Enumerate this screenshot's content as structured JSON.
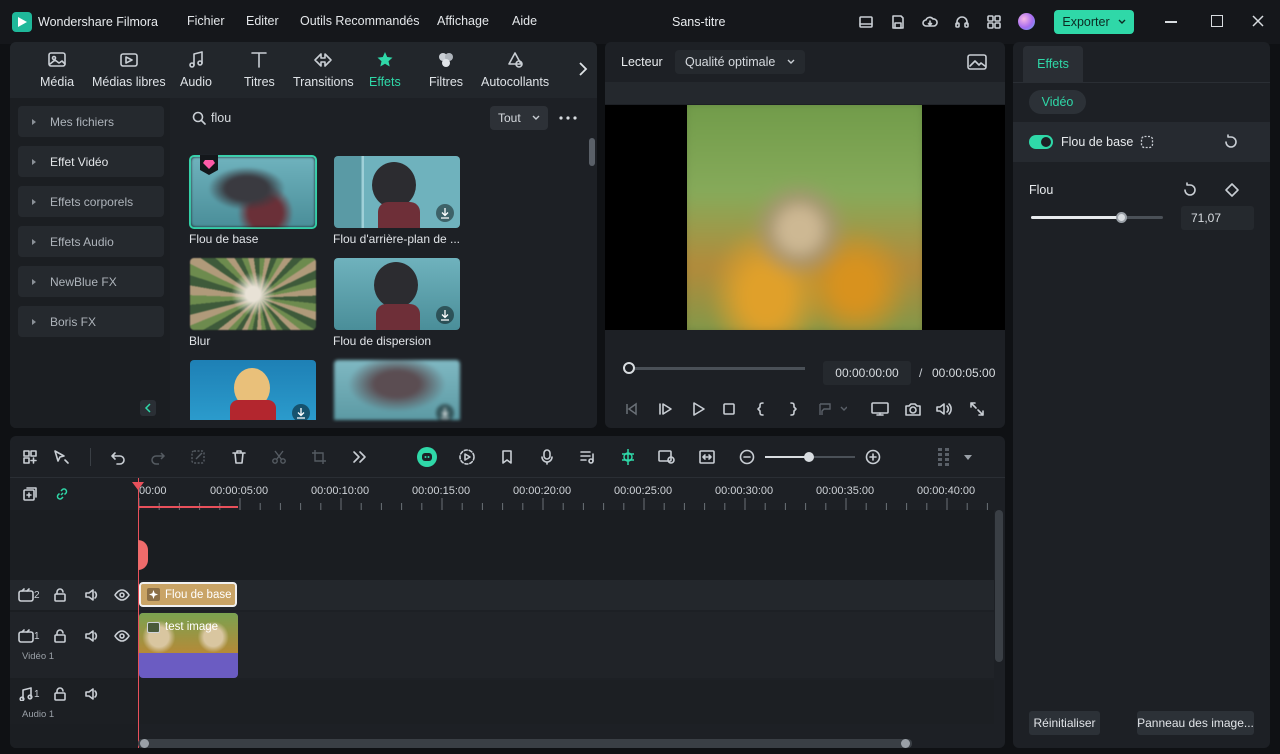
{
  "app": {
    "name": "Wondershare Filmora",
    "title": "Sans-titre"
  },
  "menu": [
    "Fichier",
    "Editer",
    "Outils Recommandés",
    "Affichage",
    "Aide"
  ],
  "export_label": "Exporter",
  "library": {
    "tabs": [
      "Média",
      "Médias libres",
      "Audio",
      "Titres",
      "Transitions",
      "Effets",
      "Filtres",
      "Autocollants"
    ],
    "active_tab": "Effets",
    "categories": [
      "Mes fichiers",
      "Effet Vidéo",
      "Effets corporels",
      "Effets Audio",
      "NewBlue FX",
      "Boris FX"
    ],
    "search_value": "flou",
    "filter_label": "Tout",
    "items": [
      {
        "label": "Flou de base"
      },
      {
        "label": "Flou d'arrière-plan de ..."
      },
      {
        "label": "Blur"
      },
      {
        "label": "Flou de dispersion"
      },
      {
        "label": ""
      },
      {
        "label": ""
      }
    ]
  },
  "player": {
    "tab_label": "Lecteur",
    "quality": "Qualité optimale",
    "current_time": "00:00:00:00",
    "separator": "/",
    "total_time": "00:00:05:00"
  },
  "properties": {
    "tab": "Effets",
    "subtab": "Vidéo",
    "effect_name": "Flou de base",
    "param_label": "Flou",
    "param_value": "71,07",
    "slider_fraction": 0.68,
    "reset_button": "Réinitialiser",
    "panel_button": "Panneau des image..."
  },
  "timeline": {
    "ruler": [
      "00:00",
      "00:00:05:00",
      "00:00:10:00",
      "00:00:15:00",
      "00:00:20:00",
      "00:00:25:00",
      "00:00:30:00",
      "00:00:35:00",
      "00:00:40:00"
    ],
    "tracks": [
      {
        "num": "2",
        "label": ""
      },
      {
        "num": "1",
        "label": "Vidéo 1"
      },
      {
        "num": "1",
        "label": "Audio 1"
      }
    ],
    "effect_clip": "Flou de base",
    "video_clip": "test image"
  },
  "colors": {
    "accent": "#2fd8a8",
    "playhead": "#e8505b",
    "clip_effect": "#c9a466",
    "clip_video_bottom": "#7a5cc4"
  }
}
